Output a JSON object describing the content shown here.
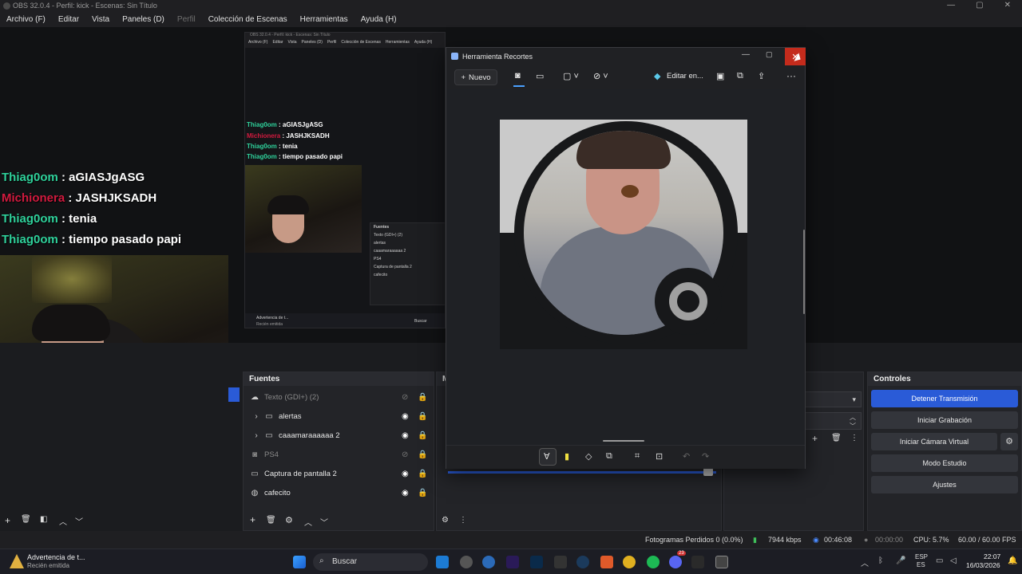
{
  "obs": {
    "title": "OBS 32.0.4 - Perfil: kick - Escenas: Sin Título",
    "menu": [
      "Archivo (F)",
      "Editar",
      "Vista",
      "Paneles (D)",
      "Perfil",
      "Colección de Escenas",
      "Herramientas",
      "Ayuda (H)"
    ],
    "window_buttons": [
      "—",
      "▢",
      "✕"
    ]
  },
  "chat": [
    {
      "user": "Thiag0om",
      "msg": ": aGIASJgASG",
      "color": "#2fd19b"
    },
    {
      "user": "Michionera",
      "msg": ": JASHJKSADH",
      "color": "#d01a3e"
    },
    {
      "user": "Thiag0om",
      "msg": ": tenia",
      "color": "#2fd19b"
    },
    {
      "user": "Thiag0om",
      "msg": ": tiempo pasado papi",
      "color": "#2fd19b"
    }
  ],
  "nested": {
    "title": "OBS 32.0.4 - Perfil: kick - Escenas: Sin Título",
    "menu": [
      "Archivo (F)",
      "Editar",
      "Vista",
      "Paneles (D)",
      "Perfil",
      "Colección de Escenas",
      "Herramientas",
      "Ayuda (H)"
    ],
    "chat": [
      {
        "user": "Thiag0om",
        "msg": ": aGIASJgASG"
      },
      {
        "user": "Michionera",
        "msg": ": JASHJKSADH"
      },
      {
        "user": "Thiag0om",
        "msg": ": tenia"
      },
      {
        "user": "Thiag0om",
        "msg": ": tiempo pasado papi"
      }
    ],
    "dock_title": "Fuentes",
    "dock_items": [
      "Texto (GDI+) (2)",
      "alertas",
      "caaamaraaaaaa 2",
      "PS4",
      "Captura de pantalla 2",
      "cafecito"
    ],
    "notif_title": "Advertencia de t...",
    "notif_sub": "Recién emitida",
    "search": "Buscar"
  },
  "sources": {
    "title": "Fuentes",
    "items": [
      {
        "label": "Texto (GDI+) (2)",
        "icon": "text-icon",
        "visible": false,
        "expand": false
      },
      {
        "label": "alertas",
        "icon": "folder-icon",
        "visible": true,
        "expand": true
      },
      {
        "label": "caaamaraaaaaa 2",
        "icon": "folder-icon",
        "visible": true,
        "expand": true
      },
      {
        "label": "PS4",
        "icon": "camera-icon",
        "visible": false,
        "expand": false
      },
      {
        "label": "Captura de pantalla 2",
        "icon": "monitor-icon",
        "visible": true,
        "expand": false
      },
      {
        "label": "cafecito",
        "icon": "globe-icon",
        "visible": true,
        "expand": false
      }
    ]
  },
  "mixer_partial": "M",
  "controls": {
    "title": "Controles",
    "buttons": [
      "Detener Transmisión",
      "Iniciar Grabación",
      "Iniciar Cámara Virtual",
      "Modo Estudio",
      "Ajustes"
    ]
  },
  "status": {
    "dropped": "Fotogramas Perdidos 0 (0.0%)",
    "bitrate": "7944 kbps",
    "live_time": "00:46:08",
    "rec_time": "00:00:00",
    "cpu": "CPU: 5.7%",
    "fps": "60.00 / 60.00 FPS"
  },
  "snip": {
    "title": "Herramienta Recortes",
    "new_label": "Nuevo",
    "edit_label": "Editar en...",
    "more": "···"
  },
  "taskbar": {
    "notif_title": "Advertencia de t...",
    "notif_sub": "Recién emitida",
    "search": "Buscar",
    "lang": "ESP",
    "lang_sub": "ES",
    "time": "22:07",
    "date": "16/03/2026",
    "discord_badge": "23"
  },
  "colors": {
    "accent": "#2a5bd7",
    "close_red": "#c42b1c"
  }
}
